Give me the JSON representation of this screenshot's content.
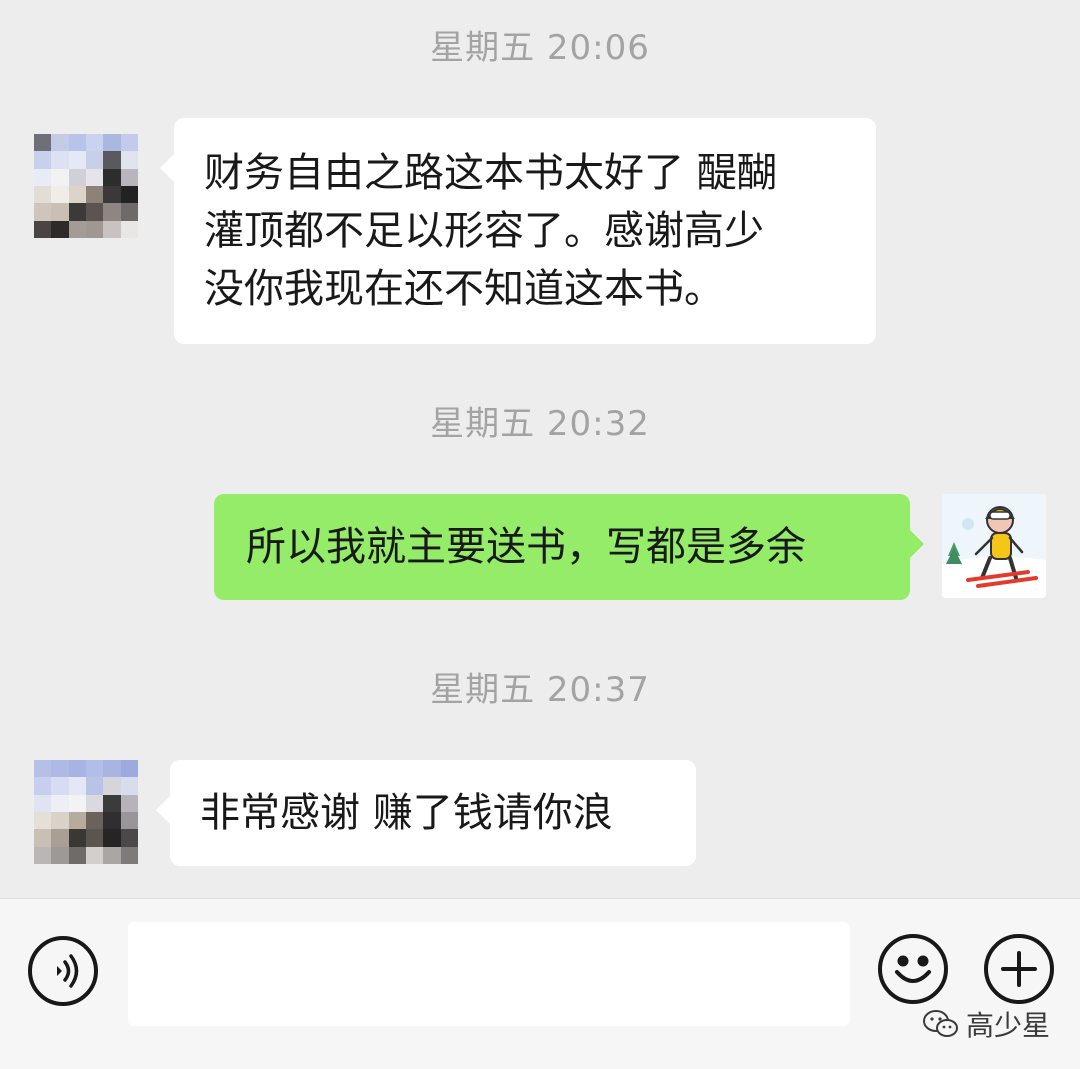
{
  "conversation": {
    "messages": [
      {
        "timestamp": "星期五 20:06",
        "direction": "incoming",
        "text": "财务自由之路这本书太好了 醍醐\n灌顶都不足以形容了。感谢高少\n没你我现在还不知道这本书。"
      },
      {
        "timestamp": "星期五 20:32",
        "direction": "outgoing",
        "text": "所以我就主要送书，写都是多余"
      },
      {
        "timestamp": "星期五 20:37",
        "direction": "incoming",
        "text": "非常感谢 赚了钱请你浪"
      }
    ]
  },
  "input_bar": {
    "voice_icon": "voice-icon",
    "emoji_icon": "emoji-icon",
    "plus_icon": "plus-icon",
    "input_value": ""
  },
  "watermark": {
    "icon": "wechat-icon",
    "text": "高少星"
  },
  "colors": {
    "background": "#ededed",
    "incoming_bubble": "#ffffff",
    "outgoing_bubble": "#95ec69",
    "timestamp": "#a3a3a3"
  }
}
